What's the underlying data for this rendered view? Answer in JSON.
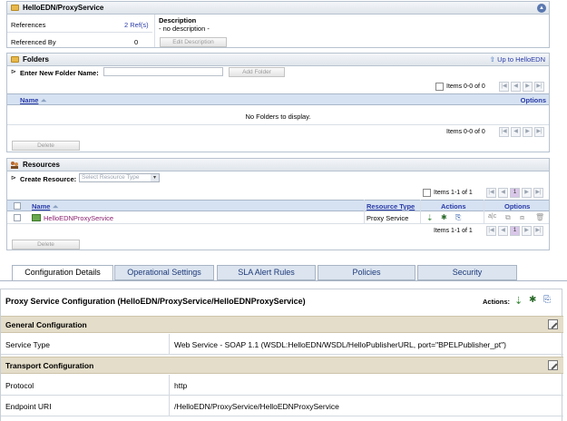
{
  "header": {
    "title": "HelloEDN/ProxyService"
  },
  "info": {
    "references_label": "References",
    "references_value": "2 Ref(s)",
    "referenced_by_label": "Referenced By",
    "referenced_by_value": "0",
    "description_label": "Description",
    "description_value": "- no description -",
    "edit_description": "Edit Description"
  },
  "folders": {
    "title": "Folders",
    "up_link": "Up to HelloEDN",
    "new_folder_label": "Enter New Folder Name:",
    "add_folder": "Add Folder",
    "pager_top": "Items 0-0 of 0",
    "col_name": "Name",
    "col_options": "Options",
    "empty": "No Folders to display.",
    "pager_bottom": "Items 0-0 of 0",
    "delete": "Delete"
  },
  "resources": {
    "title": "Resources",
    "create_label": "Create Resource:",
    "select_placeholder": "Select Resource Type",
    "pager_top": "Items 1-1 of 1",
    "page": "1",
    "col_name": "Name",
    "col_type": "Resource Type",
    "col_actions": "Actions",
    "col_options": "Options",
    "rows": [
      {
        "name": "HelloEDNProxyService",
        "type": "Proxy Service"
      }
    ],
    "pager_bottom": "Items 1-1 of 1",
    "delete": "Delete"
  },
  "tabs": [
    "Configuration Details",
    "Operational Settings",
    "SLA Alert Rules",
    "Policies",
    "Security"
  ],
  "config": {
    "title": "Proxy Service Configuration (HelloEDN/ProxyService/HelloEDNProxyService)",
    "actions_label": "Actions:",
    "general": "General Configuration",
    "service_type_label": "Service Type",
    "service_type_value": "Web Service - SOAP 1.1 (WSDL:HelloEDN/WSDL/HelloPublisherURL, port=\"BPELPublisher_pt\")",
    "transport": "Transport Configuration",
    "protocol_label": "Protocol",
    "protocol_value": "http",
    "endpoint_label": "Endpoint URI",
    "endpoint_value": "/HelloEDN/ProxyService/HelloEDNProxyService"
  }
}
